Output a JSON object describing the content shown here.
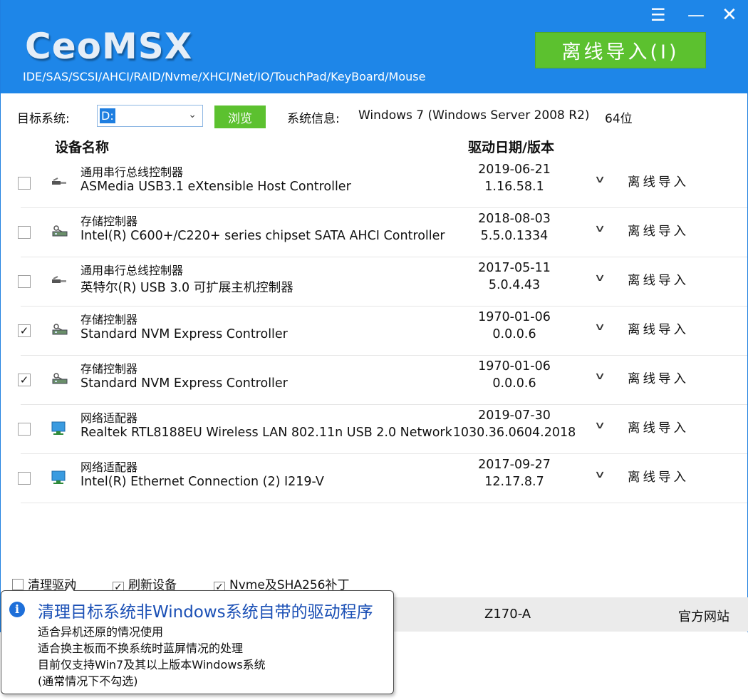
{
  "app": {
    "logo": "CeoMSX",
    "subtitle": "IDE/SAS/SCSI/AHCI/RAID/Nvme/XHCI/Net/IO/TouchPad/KeyBoard/Mouse",
    "offline_import_label": "离线导入(I)",
    "window_controls": [
      "menu-icon",
      "minimize-icon",
      "close-icon"
    ]
  },
  "target": {
    "label": "目标系统:",
    "selected": "D:",
    "browse_label": "浏览",
    "sysinfo_label": "系统信息:",
    "sysinfo_value": "Windows 7 (Windows Server 2008 R2)",
    "bits": "64位"
  },
  "columns": {
    "device_name": "设备名称",
    "driver_date_version": "驱动日期/版本"
  },
  "devices": [
    {
      "checked": false,
      "icon": "usb-icon",
      "category": "通用串行总线控制器",
      "name": "ASMedia USB3.1 eXtensible Host Controller",
      "date": "2019-06-21",
      "version": "1.16.58.1",
      "action": "离线导入"
    },
    {
      "checked": false,
      "icon": "storage-icon",
      "category": "存储控制器",
      "name": "Intel(R) C600+/C220+ series chipset SATA AHCI Controller",
      "date": "2018-08-03",
      "version": "5.5.0.1334",
      "action": "离线导入"
    },
    {
      "checked": false,
      "icon": "usb-icon",
      "category": "通用串行总线控制器",
      "name": "英特尔(R) USB 3.0 可扩展主机控制器",
      "date": "2017-05-11",
      "version": "5.0.4.43",
      "action": "离线导入"
    },
    {
      "checked": true,
      "icon": "storage-icon",
      "category": "存储控制器",
      "name": "Standard NVM Express Controller",
      "date": "1970-01-06",
      "version": "0.0.0.6",
      "action": "离线导入"
    },
    {
      "checked": true,
      "icon": "storage-icon",
      "category": "存储控制器",
      "name": "Standard NVM Express Controller",
      "date": "1970-01-06",
      "version": "0.0.0.6",
      "action": "离线导入"
    },
    {
      "checked": false,
      "icon": "network-icon",
      "category": "网络适配器",
      "name": "Realtek RTL8188EU Wireless LAN 802.11n USB 2.0 Network",
      "date": "2019-07-30",
      "version": "1030.36.0604.2018",
      "action": "离线导入"
    },
    {
      "checked": false,
      "icon": "network-icon",
      "category": "网络适配器",
      "name": "Intel(R) Ethernet Connection (2) I219-V",
      "date": "2017-09-27",
      "version": "12.17.8.7",
      "action": "离线导入"
    }
  ],
  "options": [
    {
      "label": "清理驱动",
      "checked": false
    },
    {
      "label": "刷新设备",
      "checked": true
    },
    {
      "label": "Nvme及SHA256补丁",
      "checked": true
    }
  ],
  "status": {
    "model": "Z170-A",
    "website": "官方网站"
  },
  "tooltip": {
    "title": "清理目标系统非Windows系统自带的驱动程序",
    "lines": [
      "适合异机还原的情况使用",
      "适合换主板而不换系统时蓝屏情况的处理",
      "目前仅支持Win7及其以上版本Windows系统",
      "(通常情况下不勾选)"
    ]
  },
  "colors": {
    "header_blue": "#1e86e8",
    "green_button": "#5cc12f",
    "tooltip_title": "#1a4fb5"
  }
}
